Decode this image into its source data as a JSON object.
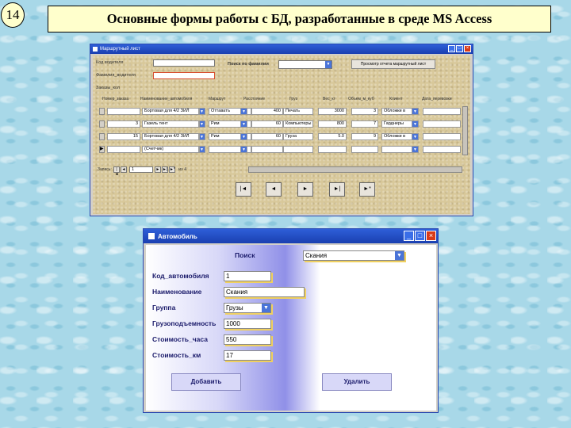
{
  "slide": {
    "number": "14",
    "title": "Основные формы работы с БД, разработанные в среде MS Access"
  },
  "route_form": {
    "title": "Маршрутный лист",
    "top_fields": {
      "driver_code_label": "Код водителя",
      "driver_name_label": "Фамилия_водителя",
      "search_label": "Поиск по фамилии",
      "preview_button": "Просмотр отчета маршрутный лист",
      "trips_label": "Заказы_кол"
    },
    "columns": [
      "Номер_заказа",
      "Наименование_автомобиля",
      "Маршрут",
      "Расстояние",
      "Груз",
      "Вес_кг",
      "Объем_м_куб",
      "Клиент",
      "Дата_перевозки"
    ],
    "rows": [
      {
        "num": "",
        "car": "Бортовая для 4/2 ЗИЛ",
        "route": "Оттаватъ",
        "distance": "400",
        "cargo": "Печать",
        "weight": "3000",
        "volume": "3",
        "client": "Обложки в"
      },
      {
        "num": "3",
        "car": "Газель тент",
        "route": "Рим",
        "distance": "60",
        "cargo": "Компьютеры",
        "weight": "800",
        "volume": "7",
        "client": "Гарднеры"
      },
      {
        "num": "15",
        "car": "Бортовая для 4/2 ЗИЛ",
        "route": "Рим",
        "distance": "60",
        "cargo": "Груза",
        "weight": "5.0",
        "volume": "9",
        "client": "Обложки в"
      },
      {
        "num": "",
        "car": "(Счетчик)",
        "route": "",
        "distance": "",
        "cargo": "",
        "weight": "",
        "volume": "",
        "client": ""
      }
    ],
    "navigator": {
      "record_label": "Запись:",
      "record_value": "1",
      "of_label": "из 4"
    },
    "nav_buttons": [
      "|◄",
      "◄",
      "►",
      "►|",
      "►*"
    ]
  },
  "car_form": {
    "title": "Автомобиль",
    "search_label": "Поиск",
    "search_value": "Скания",
    "fields": [
      {
        "label": "Код_автомобиля",
        "value": "1"
      },
      {
        "label": "Наименование",
        "value": "Скания"
      },
      {
        "label": "Группа",
        "value": "Грузы"
      },
      {
        "label": "Грузоподъемность",
        "value": "1000"
      },
      {
        "label": "Стоимость_часа",
        "value": "550"
      },
      {
        "label": "Стоимость_км",
        "value": "17"
      }
    ],
    "add_button": "Добавить",
    "delete_button": "Удалить"
  },
  "colors": {
    "background": "#a8d8e8",
    "title_box": "#ffffcc",
    "window_titlebar": "#1a3fb0",
    "form_texture": "#d8c89a"
  }
}
